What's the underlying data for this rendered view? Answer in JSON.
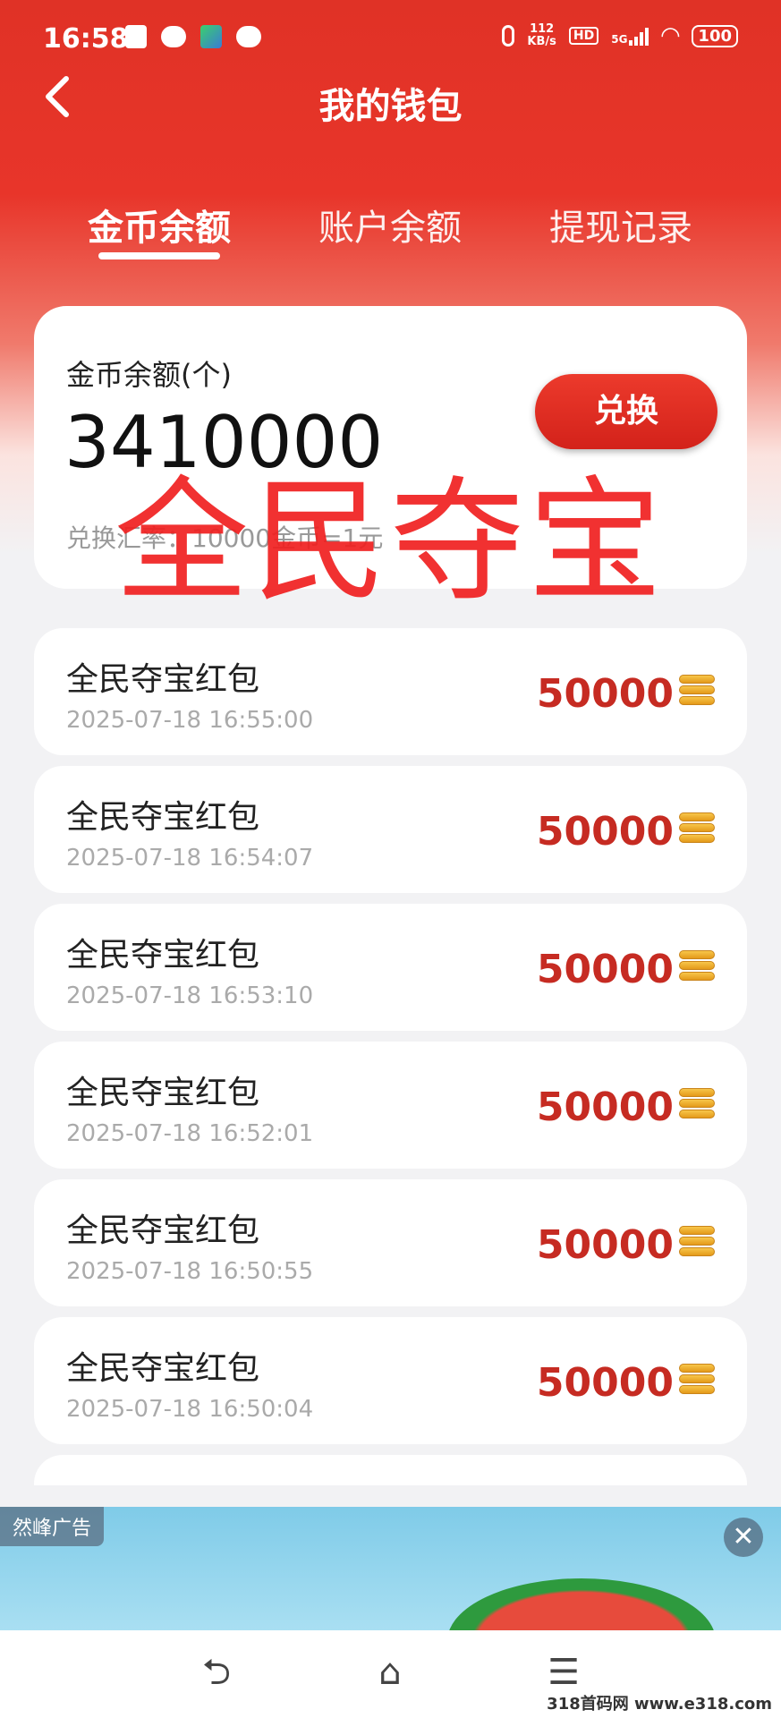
{
  "status_bar": {
    "time": "16:58",
    "net_speed_value": "112",
    "net_speed_unit": "KB/s",
    "hd": "HD",
    "network": "5G",
    "battery": "100"
  },
  "header": {
    "title": "我的钱包"
  },
  "tabs": [
    {
      "label": "金币余额"
    },
    {
      "label": "账户余额"
    },
    {
      "label": "提现记录"
    }
  ],
  "balance": {
    "label": "金币余额(个)",
    "value": "3410000",
    "exchange_button": "兑换",
    "rate": "兑换汇率：10000金币=1元"
  },
  "watermark": "全民夺宝",
  "records": [
    {
      "name": "全民夺宝红包",
      "time": "2025-07-18 16:55:00",
      "amount": "50000"
    },
    {
      "name": "全民夺宝红包",
      "time": "2025-07-18 16:54:07",
      "amount": "50000"
    },
    {
      "name": "全民夺宝红包",
      "time": "2025-07-18 16:53:10",
      "amount": "50000"
    },
    {
      "name": "全民夺宝红包",
      "time": "2025-07-18 16:52:01",
      "amount": "50000"
    },
    {
      "name": "全民夺宝红包",
      "time": "2025-07-18 16:50:55",
      "amount": "50000"
    },
    {
      "name": "全民夺宝红包",
      "time": "2025-07-18 16:50:04",
      "amount": "50000"
    }
  ],
  "ad": {
    "label": "然峰广告",
    "close": "✕"
  },
  "nav": {
    "back": "⮌",
    "home": "⌂",
    "menu": "☰"
  },
  "footer_watermark": "318首码网 www.e318.com",
  "colors": {
    "primary_red": "#e03226",
    "amount_red": "#c62b22"
  }
}
